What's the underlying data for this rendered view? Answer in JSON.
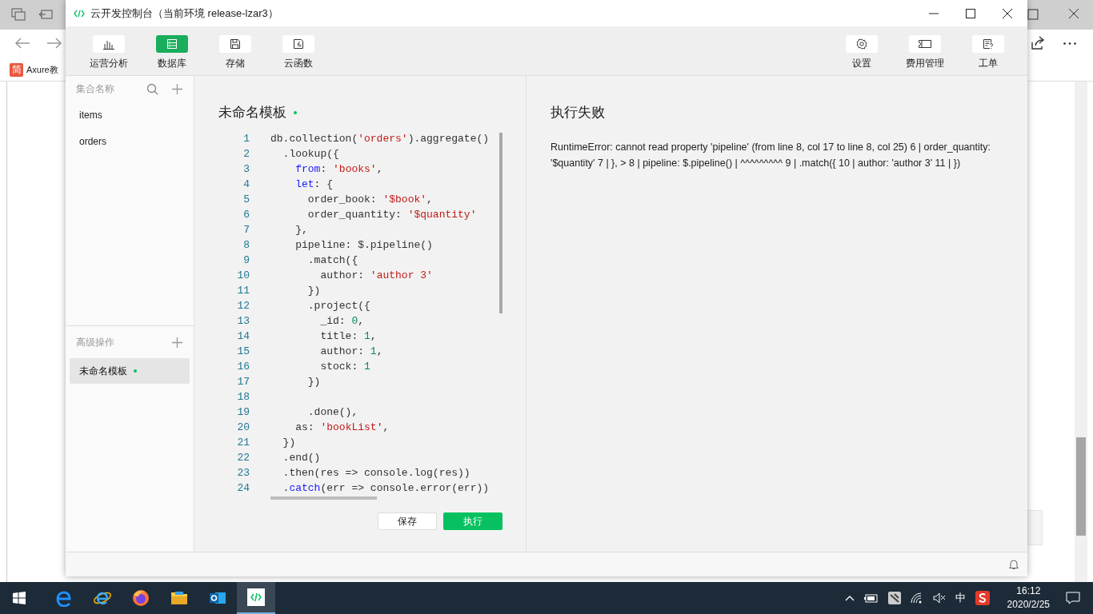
{
  "browser": {
    "bookmark_icon": "简",
    "bookmark": "Axure教"
  },
  "window": {
    "title": "云开发控制台（当前环境 release-lzar3）"
  },
  "toolbar": {
    "left": [
      {
        "label": "运营分析",
        "selected": false
      },
      {
        "label": "数据库",
        "selected": true
      },
      {
        "label": "存储",
        "selected": false
      },
      {
        "label": "云函数",
        "selected": false
      }
    ],
    "right": [
      {
        "label": "设置",
        "selected": false
      },
      {
        "label": "费用管理",
        "selected": false
      },
      {
        "label": "工单",
        "selected": false
      }
    ]
  },
  "sidebar": {
    "collections_header": "集合名称",
    "collections": [
      {
        "label": "items",
        "selected": false
      },
      {
        "label": "orders",
        "selected": false
      }
    ],
    "advanced_header": "高级操作",
    "templates": [
      {
        "label": "未命名模板",
        "selected": true,
        "unsaved": true
      }
    ]
  },
  "editor": {
    "title": "未命名模板",
    "unsaved": true,
    "lines": [
      {
        "num": "1",
        "tokens": [
          {
            "text": "db.collection(",
            "kind": "plain"
          },
          {
            "text": "'orders'",
            "kind": "str"
          },
          {
            "text": ").aggregate()",
            "kind": "plain"
          }
        ]
      },
      {
        "num": "2",
        "tokens": [
          {
            "text": "  .lookup({",
            "kind": "plain"
          }
        ]
      },
      {
        "num": "3",
        "tokens": [
          {
            "text": "    from",
            "kind": "key"
          },
          {
            "text": ": ",
            "kind": "plain"
          },
          {
            "text": "'books'",
            "kind": "str"
          },
          {
            "text": ",",
            "kind": "plain"
          }
        ]
      },
      {
        "num": "4",
        "tokens": [
          {
            "text": "    let",
            "kind": "key"
          },
          {
            "text": ": {",
            "kind": "plain"
          }
        ]
      },
      {
        "num": "5",
        "tokens": [
          {
            "text": "      order_book: ",
            "kind": "plain"
          },
          {
            "text": "'$book'",
            "kind": "str"
          },
          {
            "text": ",",
            "kind": "plain"
          }
        ]
      },
      {
        "num": "6",
        "tokens": [
          {
            "text": "      order_quantity: ",
            "kind": "plain"
          },
          {
            "text": "'$quantity'",
            "kind": "str"
          }
        ]
      },
      {
        "num": "7",
        "tokens": [
          {
            "text": "    },",
            "kind": "plain"
          }
        ]
      },
      {
        "num": "8",
        "tokens": [
          {
            "text": "    pipeline: $.pipeline()",
            "kind": "plain"
          }
        ]
      },
      {
        "num": "9",
        "tokens": [
          {
            "text": "      .match({",
            "kind": "plain"
          }
        ]
      },
      {
        "num": "10",
        "tokens": [
          {
            "text": "        author: ",
            "kind": "plain"
          },
          {
            "text": "'author 3'",
            "kind": "str"
          }
        ]
      },
      {
        "num": "11",
        "tokens": [
          {
            "text": "      })",
            "kind": "plain"
          }
        ]
      },
      {
        "num": "12",
        "tokens": [
          {
            "text": "      .project({",
            "kind": "plain"
          }
        ]
      },
      {
        "num": "13",
        "tokens": [
          {
            "text": "        _id: ",
            "kind": "plain"
          },
          {
            "text": "0",
            "kind": "num"
          },
          {
            "text": ",",
            "kind": "plain"
          }
        ]
      },
      {
        "num": "14",
        "tokens": [
          {
            "text": "        title: ",
            "kind": "plain"
          },
          {
            "text": "1",
            "kind": "num"
          },
          {
            "text": ",",
            "kind": "plain"
          }
        ]
      },
      {
        "num": "15",
        "tokens": [
          {
            "text": "        author: ",
            "kind": "plain"
          },
          {
            "text": "1",
            "kind": "num"
          },
          {
            "text": ",",
            "kind": "plain"
          }
        ]
      },
      {
        "num": "16",
        "tokens": [
          {
            "text": "        stock: ",
            "kind": "plain"
          },
          {
            "text": "1",
            "kind": "num"
          }
        ]
      },
      {
        "num": "17",
        "tokens": [
          {
            "text": "      })",
            "kind": "plain"
          }
        ]
      },
      {
        "num": "18"
      },
      {
        "num": "19",
        "tokens": [
          {
            "text": "      .done(),",
            "kind": "plain"
          }
        ]
      },
      {
        "num": "20",
        "tokens": [
          {
            "text": "    as: ",
            "kind": "plain"
          },
          {
            "text": "'bookList'",
            "kind": "str"
          },
          {
            "text": ",",
            "kind": "plain"
          }
        ]
      },
      {
        "num": "21",
        "tokens": [
          {
            "text": "  })",
            "kind": "plain"
          }
        ]
      },
      {
        "num": "22",
        "tokens": [
          {
            "text": "  .end()",
            "kind": "plain"
          }
        ]
      },
      {
        "num": "23",
        "tokens": [
          {
            "text": "  .then(res => console.log(res))",
            "kind": "plain"
          }
        ]
      },
      {
        "num": "24",
        "tokens": [
          {
            "text": "  .",
            "kind": "plain"
          },
          {
            "text": "catch",
            "kind": "key"
          },
          {
            "text": "(err => console.error(err))",
            "kind": "plain"
          }
        ]
      }
    ],
    "save_button": "保存",
    "run_button": "执行"
  },
  "result": {
    "title": "执行失败",
    "message": "RuntimeError: cannot read property 'pipeline' (from line 8, col 17 to line 8, col 25) 6 | order_quantity: '$quantity' 7 | }, > 8 | pipeline: $.pipeline() | ^^^^^^^^^ 9 | .match({ 10 | author: 'author 3' 11 | })"
  },
  "taskbar": {
    "ime": "中",
    "time": "16:12",
    "date": "2020/2/25"
  }
}
